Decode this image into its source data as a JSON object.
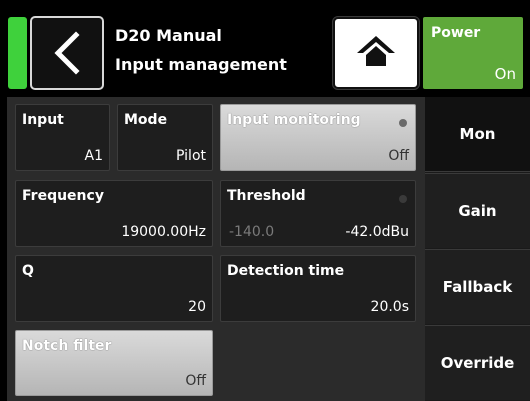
{
  "header": {
    "title": "D20 Manual",
    "subtitle": "Input management",
    "status_color": "#3fd13c",
    "back_icon": "chevron-left-icon",
    "home_icon": "home-icon"
  },
  "power": {
    "label": "Power",
    "value": "On",
    "color": "#5fa93a"
  },
  "tiles": {
    "input": {
      "label": "Input",
      "value": "A1"
    },
    "mode": {
      "label": "Mode",
      "value": "Pilot"
    },
    "input_monitoring": {
      "label": "Input monitoring",
      "value": "Off"
    },
    "frequency": {
      "label": "Frequency",
      "value": "19000.00Hz"
    },
    "threshold": {
      "label": "Threshold",
      "min": "-140.0",
      "value": "-42.0dBu"
    },
    "q": {
      "label": "Q",
      "value": "20"
    },
    "detection_time": {
      "label": "Detection time",
      "value": "20.0s"
    },
    "notch_filter": {
      "label": "Notch filter",
      "value": "Off"
    }
  },
  "tabs": [
    "Mon",
    "Gain",
    "Fallback",
    "Override"
  ]
}
